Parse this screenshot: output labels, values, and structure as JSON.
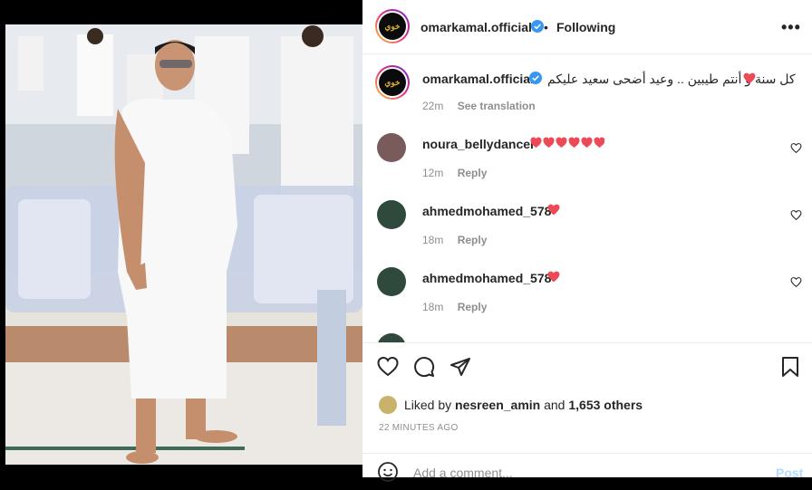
{
  "post": {
    "author": "omarkamal.official",
    "following": "Following",
    "more": "•••",
    "caption": {
      "username": "omarkamal.official",
      "text": "كل سنة و أنتم طيبين .. وعيد أضحى سعيد عليكم",
      "time": "22m",
      "translate": "See translation"
    },
    "comments": [
      {
        "username": "noura_bellydancer",
        "text": "",
        "hearts": 6,
        "time": "12m",
        "reply": "Reply"
      },
      {
        "username": "ahmedmohamed_578",
        "text": "",
        "hearts": 1,
        "time": "18m",
        "reply": "Reply"
      },
      {
        "username": "ahmedmohamed_578",
        "text": "",
        "hearts": 1,
        "time": "18m",
        "reply": "Reply"
      }
    ],
    "likes": {
      "prefix": "Liked by",
      "user": "nesreen_amin",
      "and": "and",
      "count": "1,653 others"
    },
    "timestamp": "22 MINUTES AGO",
    "add_comment": {
      "placeholder": "Add a comment...",
      "post": "Post"
    }
  },
  "colors": {
    "heart": "#ed4956",
    "verified": "#3897f0",
    "link": "#b3dbff"
  }
}
